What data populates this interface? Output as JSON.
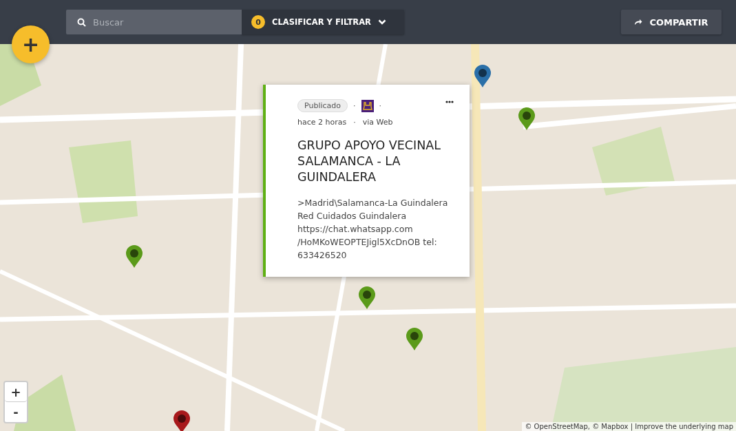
{
  "toolbar": {
    "search": {
      "placeholder": "Buscar"
    },
    "filter_button": {
      "count": "0",
      "label": "CLASIFICAR Y FILTRAR"
    },
    "share_button": {
      "label": "COMPARTIR"
    }
  },
  "add_button": {
    "label": "+"
  },
  "map": {
    "markers": [
      {
        "color": "#2a6fa8"
      },
      {
        "color": "#5b9a1a"
      },
      {
        "color": "#5b9a1a"
      },
      {
        "color": "#5b9a1a"
      },
      {
        "color": "#5b9a1a"
      },
      {
        "color": "#a8191c"
      }
    ],
    "zoom_in": "+",
    "zoom_out": "-",
    "attribution": "© OpenStreetMap, © Mapbox | Improve the underlying map"
  },
  "popup": {
    "status": "Publicado",
    "separator": "·",
    "time": "hace 2 horas",
    "source": "via Web",
    "title": "GRUPO APOYO VECINAL SALAMANCA - LA GUINDALERA",
    "body": ">Madrid\\Salamanca-La Guindalera\nRed Cuidados Guindalera\nhttps://chat.whatsapp.com\n/HoMKoWEOPTEJigl5XcDnOB tel:\n633426520"
  }
}
